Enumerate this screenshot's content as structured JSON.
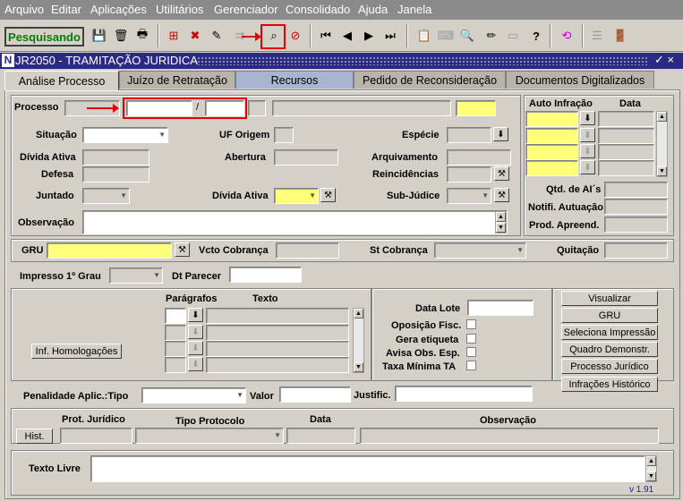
{
  "menu": [
    "Arquivo",
    "Editar",
    "Aplicações",
    "Utilitários",
    "Gerenciador",
    "Consolidado",
    "Ajuda",
    "Janela"
  ],
  "status": "Pesquisando",
  "window": {
    "title": "JR2050 - TRAMITAÇÃO JURIDICA",
    "icon_letter": "N",
    "controls": "✓ ×"
  },
  "tabs": [
    "Análise Processo",
    "Juízo de Retratação",
    "Recursos",
    "Pedido de Reconsideração",
    "Documentos Digitalizados"
  ],
  "labels": {
    "processo": "Processo",
    "slash": "/",
    "situacao": "Situação",
    "uf_origem": "UF Origem",
    "especie": "Espécie",
    "divida_ativa": "Dívida Ativa",
    "abertura": "Abertura",
    "arquivamento": "Arquivamento",
    "defesa": "Defesa",
    "reincidencias": "Reincidências",
    "juntado": "Juntado",
    "divida_ativa2": "Dívida Ativa",
    "sub_judice": "Sub-Júdice",
    "observacao": "Observação",
    "auto_infracao": "Auto Infração",
    "data": "Data",
    "qtd_ais": "Qtd. de AI´s",
    "notif_autuacao": "Notifi. Autuação",
    "prod_apreend": "Prod. Apreend.",
    "gru": "GRU",
    "vcto_cobranca": "Vcto Cobrança",
    "st_cobranca": "St Cobrança",
    "quitacao": "Quitação",
    "impresso": "Impresso 1º Grau",
    "dt_parecer": "Dt Parecer",
    "paragrafos": "Parágrafos",
    "texto": "Texto",
    "data_lote": "Data Lote",
    "oposicao": "Oposição Fisc.",
    "gera_etiqueta": "Gera etiqueta",
    "avisa_obs": "Avisa Obs. Esp.",
    "taxa_minima": "Taxa Mínima TA",
    "penalidade": "Penalidade Aplic.:Tipo",
    "valor": "Valor",
    "justific": "Justific.",
    "prot_juridico": "Prot. Jurídico",
    "tipo_protocolo": "Tipo Protocolo",
    "data2": "Data",
    "observacao2": "Observação",
    "texto_livre": "Texto Livre"
  },
  "buttons": {
    "inf_homologacoes": "Inf. Homologações",
    "visualizar": "Visualizar",
    "gru": "GRU",
    "seleciona_impressao": "Seleciona Impressão",
    "quadro_demonstr": "Quadro Demonstr.",
    "processo_juridico": "Processo Jurídico",
    "infracoes_historico": "Infrações Histórico",
    "hist": "Hist."
  },
  "version": "v 1.91"
}
